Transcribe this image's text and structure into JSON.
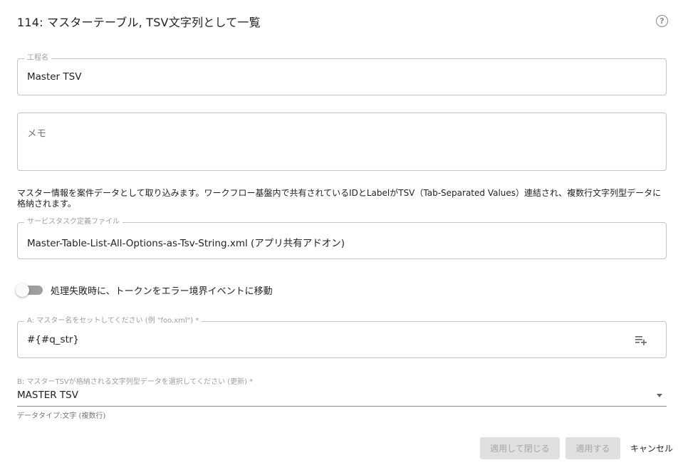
{
  "dialog": {
    "title": "114: マスターテーブル, TSV文字列として一覧",
    "help_icon": "help-circle-icon"
  },
  "step_name": {
    "label": "工程名",
    "value": "Master TSV"
  },
  "memo": {
    "placeholder": "メモ",
    "value": ""
  },
  "description": "マスター情報を案件データとして取り込みます。ワークフロー基盤内で共有されているIDとLabelがTSV（Tab-Separated Values）連結され、複数行文字列型データに格納されます。",
  "service_task": {
    "label": "サービスタスク定義ファイル",
    "value": "Master-Table-List-All-Options-as-Tsv-String.xml (アプリ共有アドオン)"
  },
  "error_toggle": {
    "label": "処理失敗時に、トークンをエラー境界イベントに移動",
    "checked": false
  },
  "field_a": {
    "label": "A: マスター名をセットしてください (例 \"foo.xml\") *",
    "value": "#{#q_str}",
    "icon": "playlist-add-icon"
  },
  "field_b": {
    "label": "B: マスターTSVが格納される文字列型データを選択してください (更新) *",
    "selected": "MASTER TSV",
    "helper": "データタイプ:文字 (複数行)"
  },
  "buttons": {
    "apply_close": "適用して閉じる",
    "apply": "適用する",
    "cancel": "キャンセル"
  },
  "colors": {
    "border": "#c4c4c4",
    "disabled_bg": "#e0e0e0",
    "disabled_text": "#a6a6a6",
    "toggle_track": "#9e9e9e"
  }
}
